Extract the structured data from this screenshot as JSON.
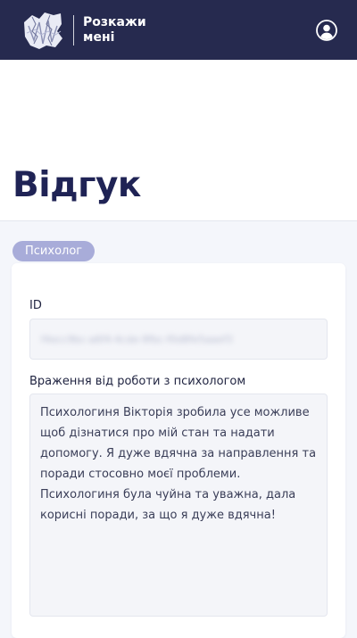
{
  "header": {
    "logo_line1": "Розкажи",
    "logo_line2": "мені",
    "logo_icon": "crumpled-paper-logo-icon",
    "user_icon": "user-account-icon"
  },
  "page": {
    "title": "Відгук",
    "badge": "Психолог"
  },
  "form": {
    "id_label": "ID",
    "id_value": "f4ecc9bc-a6f4-4cde-9fbc-f0d8fe5aaef3",
    "feedback_label": "Враження від роботи з психологом",
    "feedback_text": "Психологиня Вікторія зробила усе можливе щоб дізнатися про мій стан та надати допомогу. Я дуже вдячна за направлення та поради стосовно моєї проблеми. Психологиня була чуйна та уважна, дала корисні поради, за що я дуже вдячна!"
  },
  "colors": {
    "header_bg": "#262a4f",
    "title": "#1f2355",
    "badge_bg": "#a8acd9",
    "page_bg": "#f4f6fb"
  }
}
